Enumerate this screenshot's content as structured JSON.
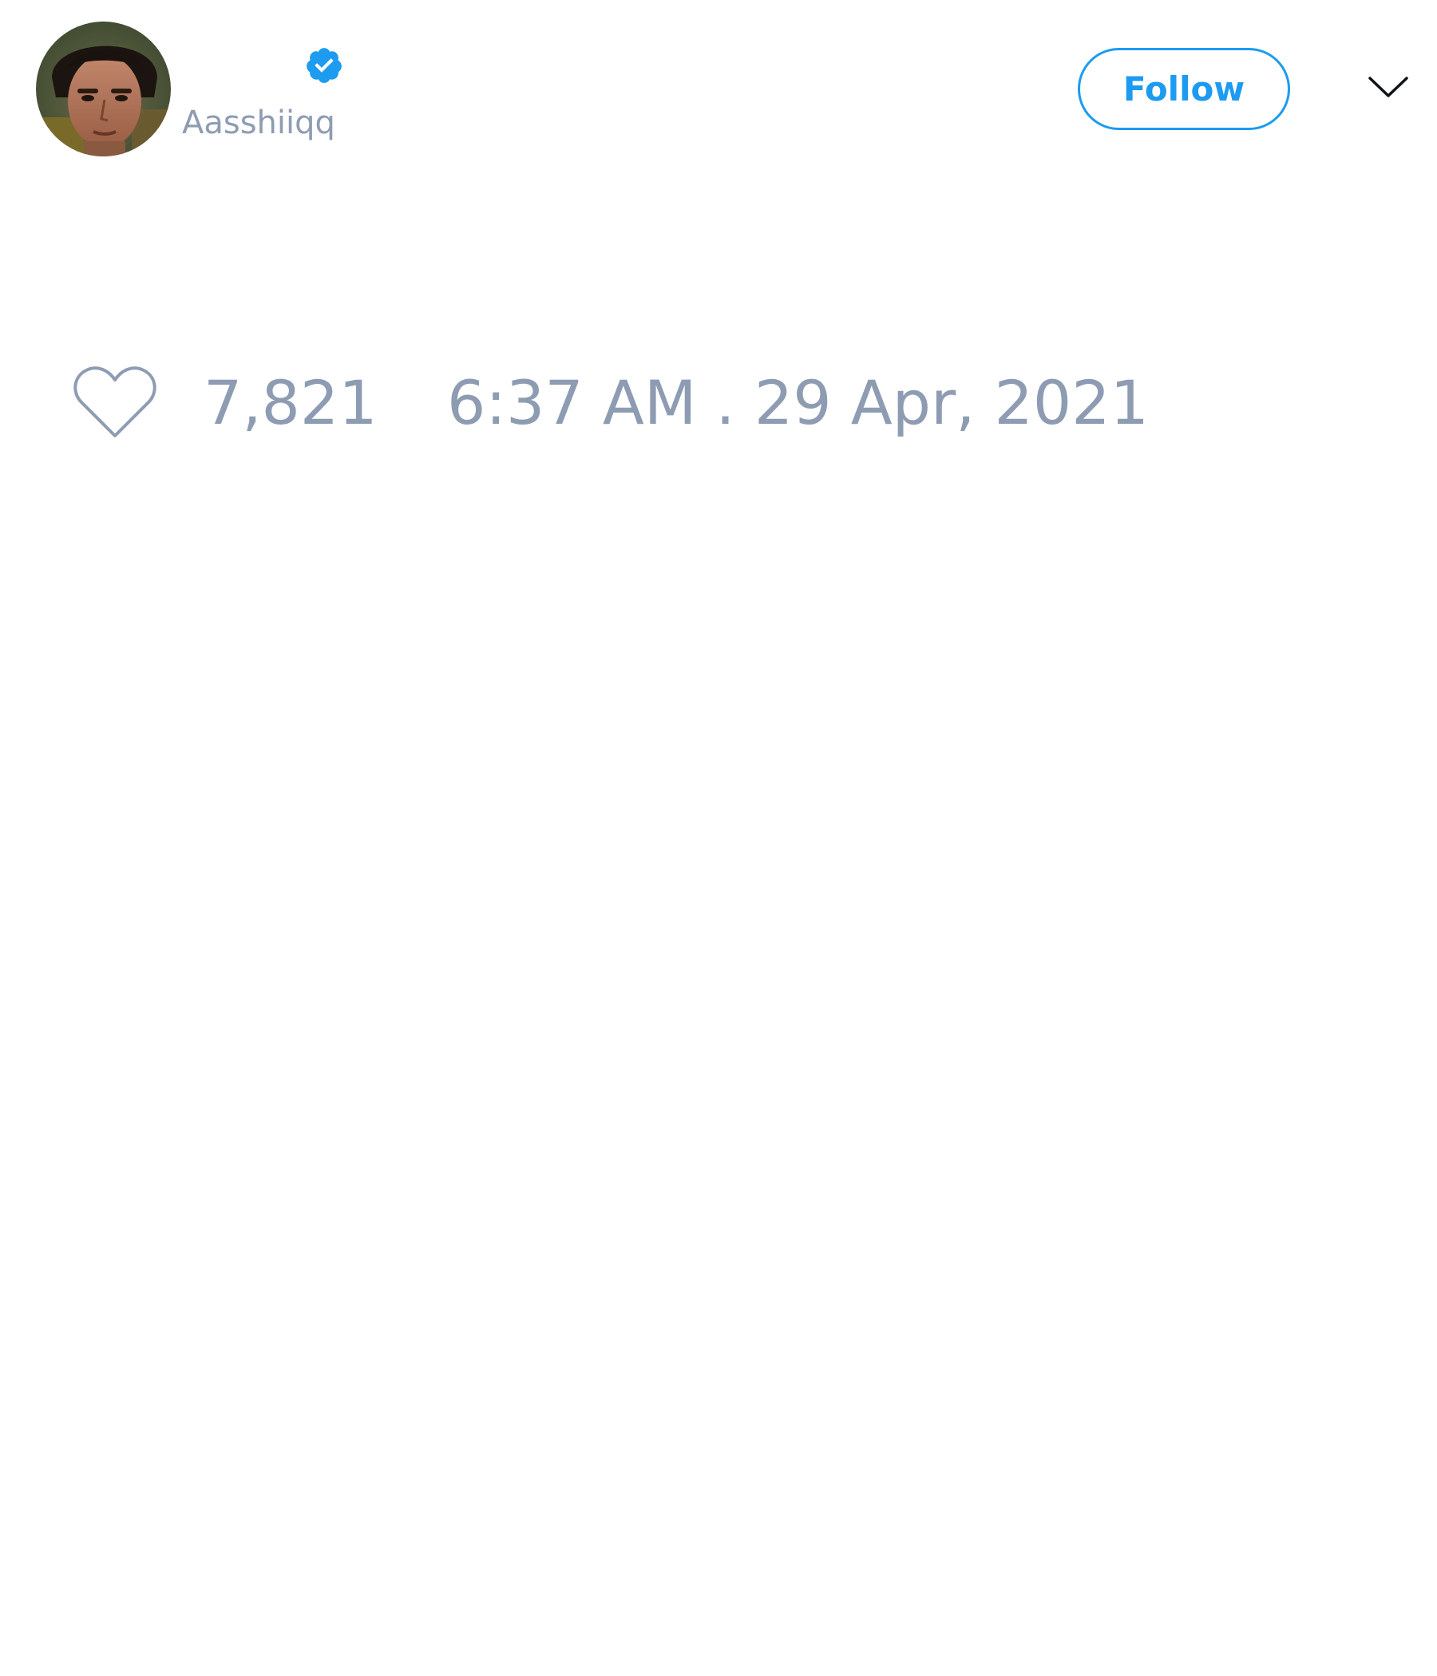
{
  "author": {
    "display_name": "",
    "handle": "Aasshiiqq",
    "verified": true
  },
  "follow_button": {
    "label": "Follow"
  },
  "icons": {
    "verified": "verified-badge-icon",
    "like": "heart-icon",
    "more": "chevron-down-icon"
  },
  "stats": {
    "likes": "7,821",
    "timestamp": "6:37 AM . 29 Apr, 2021"
  },
  "colors": {
    "accent": "#1d9bf0",
    "muted_text": "#8e9cb3",
    "background": "#ffffff"
  }
}
